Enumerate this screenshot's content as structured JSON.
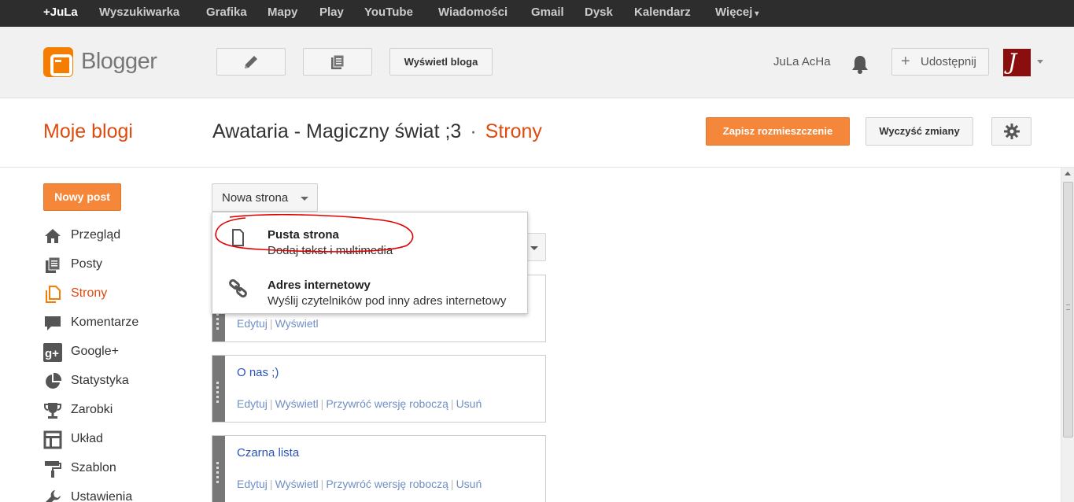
{
  "gbar": {
    "items": [
      "+JuLa",
      "Wyszukiwarka",
      "Grafika",
      "Mapy",
      "Play",
      "YouTube",
      "Wiadomości",
      "Gmail",
      "Dysk",
      "Kalendarz",
      "Więcej"
    ]
  },
  "header": {
    "logo_text": "Blogger",
    "view_blog_label": "Wyświetl bloga",
    "user_name": "JuLa AcHa",
    "share_label": "Udostępnij",
    "avatar_letter": "J"
  },
  "titlebar": {
    "my_blogs": "Moje blogi",
    "blog_name": "Awataria - Magiczny świat ;3",
    "separator": "·",
    "section": "Strony",
    "save_layout": "Zapisz rozmieszczenie",
    "clear_changes": "Wyczyść zmiany"
  },
  "sidebar": {
    "new_post": "Nowy post",
    "items": [
      {
        "label": "Przegląd",
        "icon": "home-icon"
      },
      {
        "label": "Posty",
        "icon": "posts-icon"
      },
      {
        "label": "Strony",
        "icon": "pages-icon",
        "active": true
      },
      {
        "label": "Komentarze",
        "icon": "comment-icon"
      },
      {
        "label": "Google+",
        "icon": "google-plus-icon"
      },
      {
        "label": "Statystyka",
        "icon": "stats-pie-icon"
      },
      {
        "label": "Zarobki",
        "icon": "trophy-icon"
      },
      {
        "label": "Układ",
        "icon": "layout-icon"
      },
      {
        "label": "Szablon",
        "icon": "paint-roller-icon"
      },
      {
        "label": "Ustawienia",
        "icon": "wrench-icon"
      }
    ]
  },
  "pages": {
    "new_page_label": "Nowa strona",
    "menu": [
      {
        "title": "Pusta strona",
        "subtitle": "Dodaj tekst i multimedia",
        "icon": "blank-page-icon"
      },
      {
        "title": "Adres internetowy",
        "subtitle": "Wyślij czytelników pod inny adres internetowy",
        "icon": "link-icon"
      }
    ],
    "list": [
      {
        "title": "",
        "actions": [
          "Edytuj",
          "Wyświetl"
        ]
      },
      {
        "title": "O nas ;)",
        "actions": [
          "Edytuj",
          "Wyświetl",
          "Przywróć wersję roboczą",
          "Usuń"
        ]
      },
      {
        "title": "Czarna lista",
        "actions": [
          "Edytuj",
          "Wyświetl",
          "Przywróć wersję roboczą",
          "Usuń"
        ]
      }
    ]
  },
  "colors": {
    "accent_orange": "#f5873a",
    "link_blue": "#2a55b3",
    "active_nav": "#dd4b0f",
    "annotation_red": "#e00000"
  }
}
